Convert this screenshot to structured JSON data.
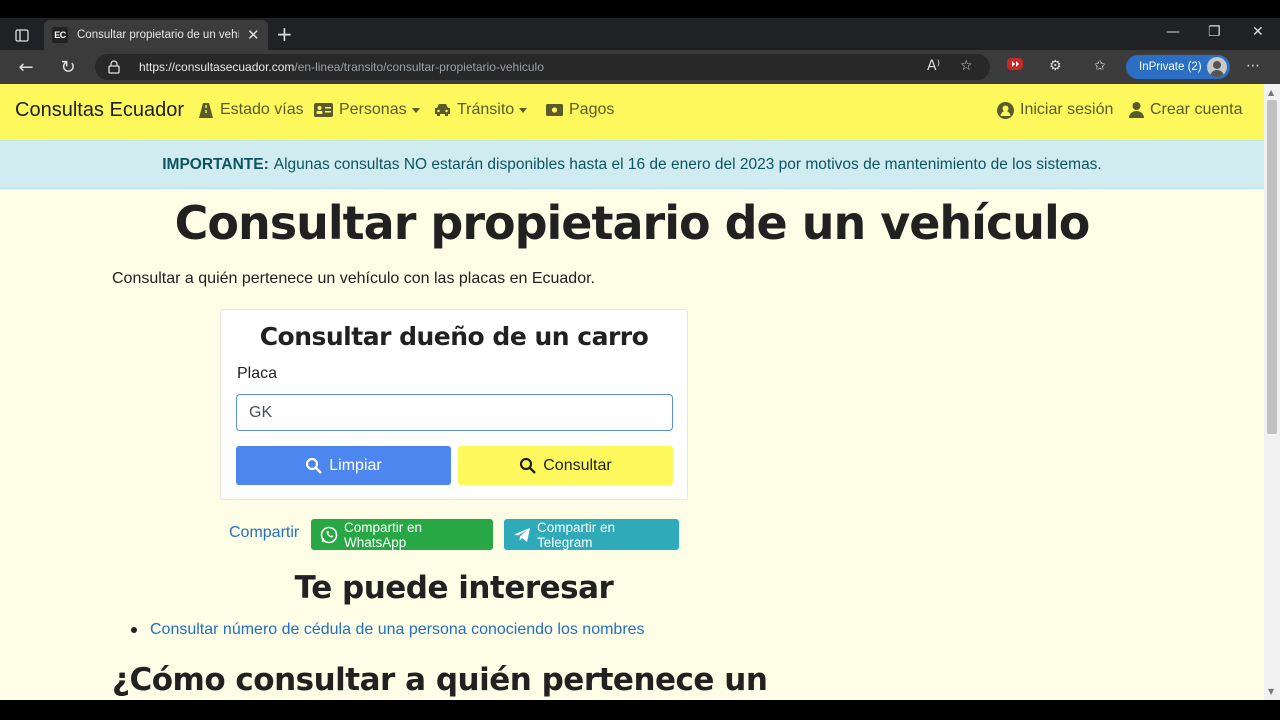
{
  "browser": {
    "tab_title": "Consultar propietario de un vehículo",
    "favicon_text": "EC",
    "url_domain": "https://consultasecuador.com",
    "url_path": "/en-linea/transito/consultar-propietario-vehiculo",
    "inprivate_label": "InPrivate (2)"
  },
  "navbar": {
    "brand": "Consultas Ecuador",
    "items": [
      {
        "label": "Estado vías",
        "icon": "road-icon"
      },
      {
        "label": "Personas",
        "icon": "id-card-icon",
        "dropdown": true
      },
      {
        "label": "Tránsito",
        "icon": "car-icon",
        "dropdown": true
      },
      {
        "label": "Pagos",
        "icon": "money-icon"
      }
    ],
    "login": "Iniciar sesión",
    "register": "Crear cuenta"
  },
  "alert": {
    "strong": "IMPORTANTE:",
    "text": "Algunas consultas NO estarán disponibles hasta el 16 de enero del 2023 por motivos de mantenimiento de los sistemas."
  },
  "main": {
    "title": "Consultar propietario de un vehículo",
    "lead": "Consultar a quién pertenece un vehículo con las placas en Ecuador."
  },
  "form": {
    "title": "Consultar dueño de un carro",
    "plate_label": "Placa",
    "plate_value": "GK",
    "clear_button": "Limpiar",
    "query_button": "Consultar"
  },
  "share": {
    "link": "Compartir",
    "whatsapp": "Compartir en WhatsApp",
    "telegram": "Compartir en Telegram"
  },
  "related": {
    "title": "Te puede interesar",
    "items": [
      "Consultar número de cédula de una persona conociendo los nombres"
    ]
  },
  "section": {
    "title": "¿Cómo consultar a quién pertenece un"
  },
  "colors": {
    "navbar": "#fdf95c",
    "page_bg": "#fefee6",
    "alert_bg": "#d1ecf0",
    "clear_button": "#4e86f0",
    "query_button": "#fdf95c",
    "whatsapp": "#28a745",
    "telegram": "#2eaab8",
    "link": "#2470c0"
  }
}
